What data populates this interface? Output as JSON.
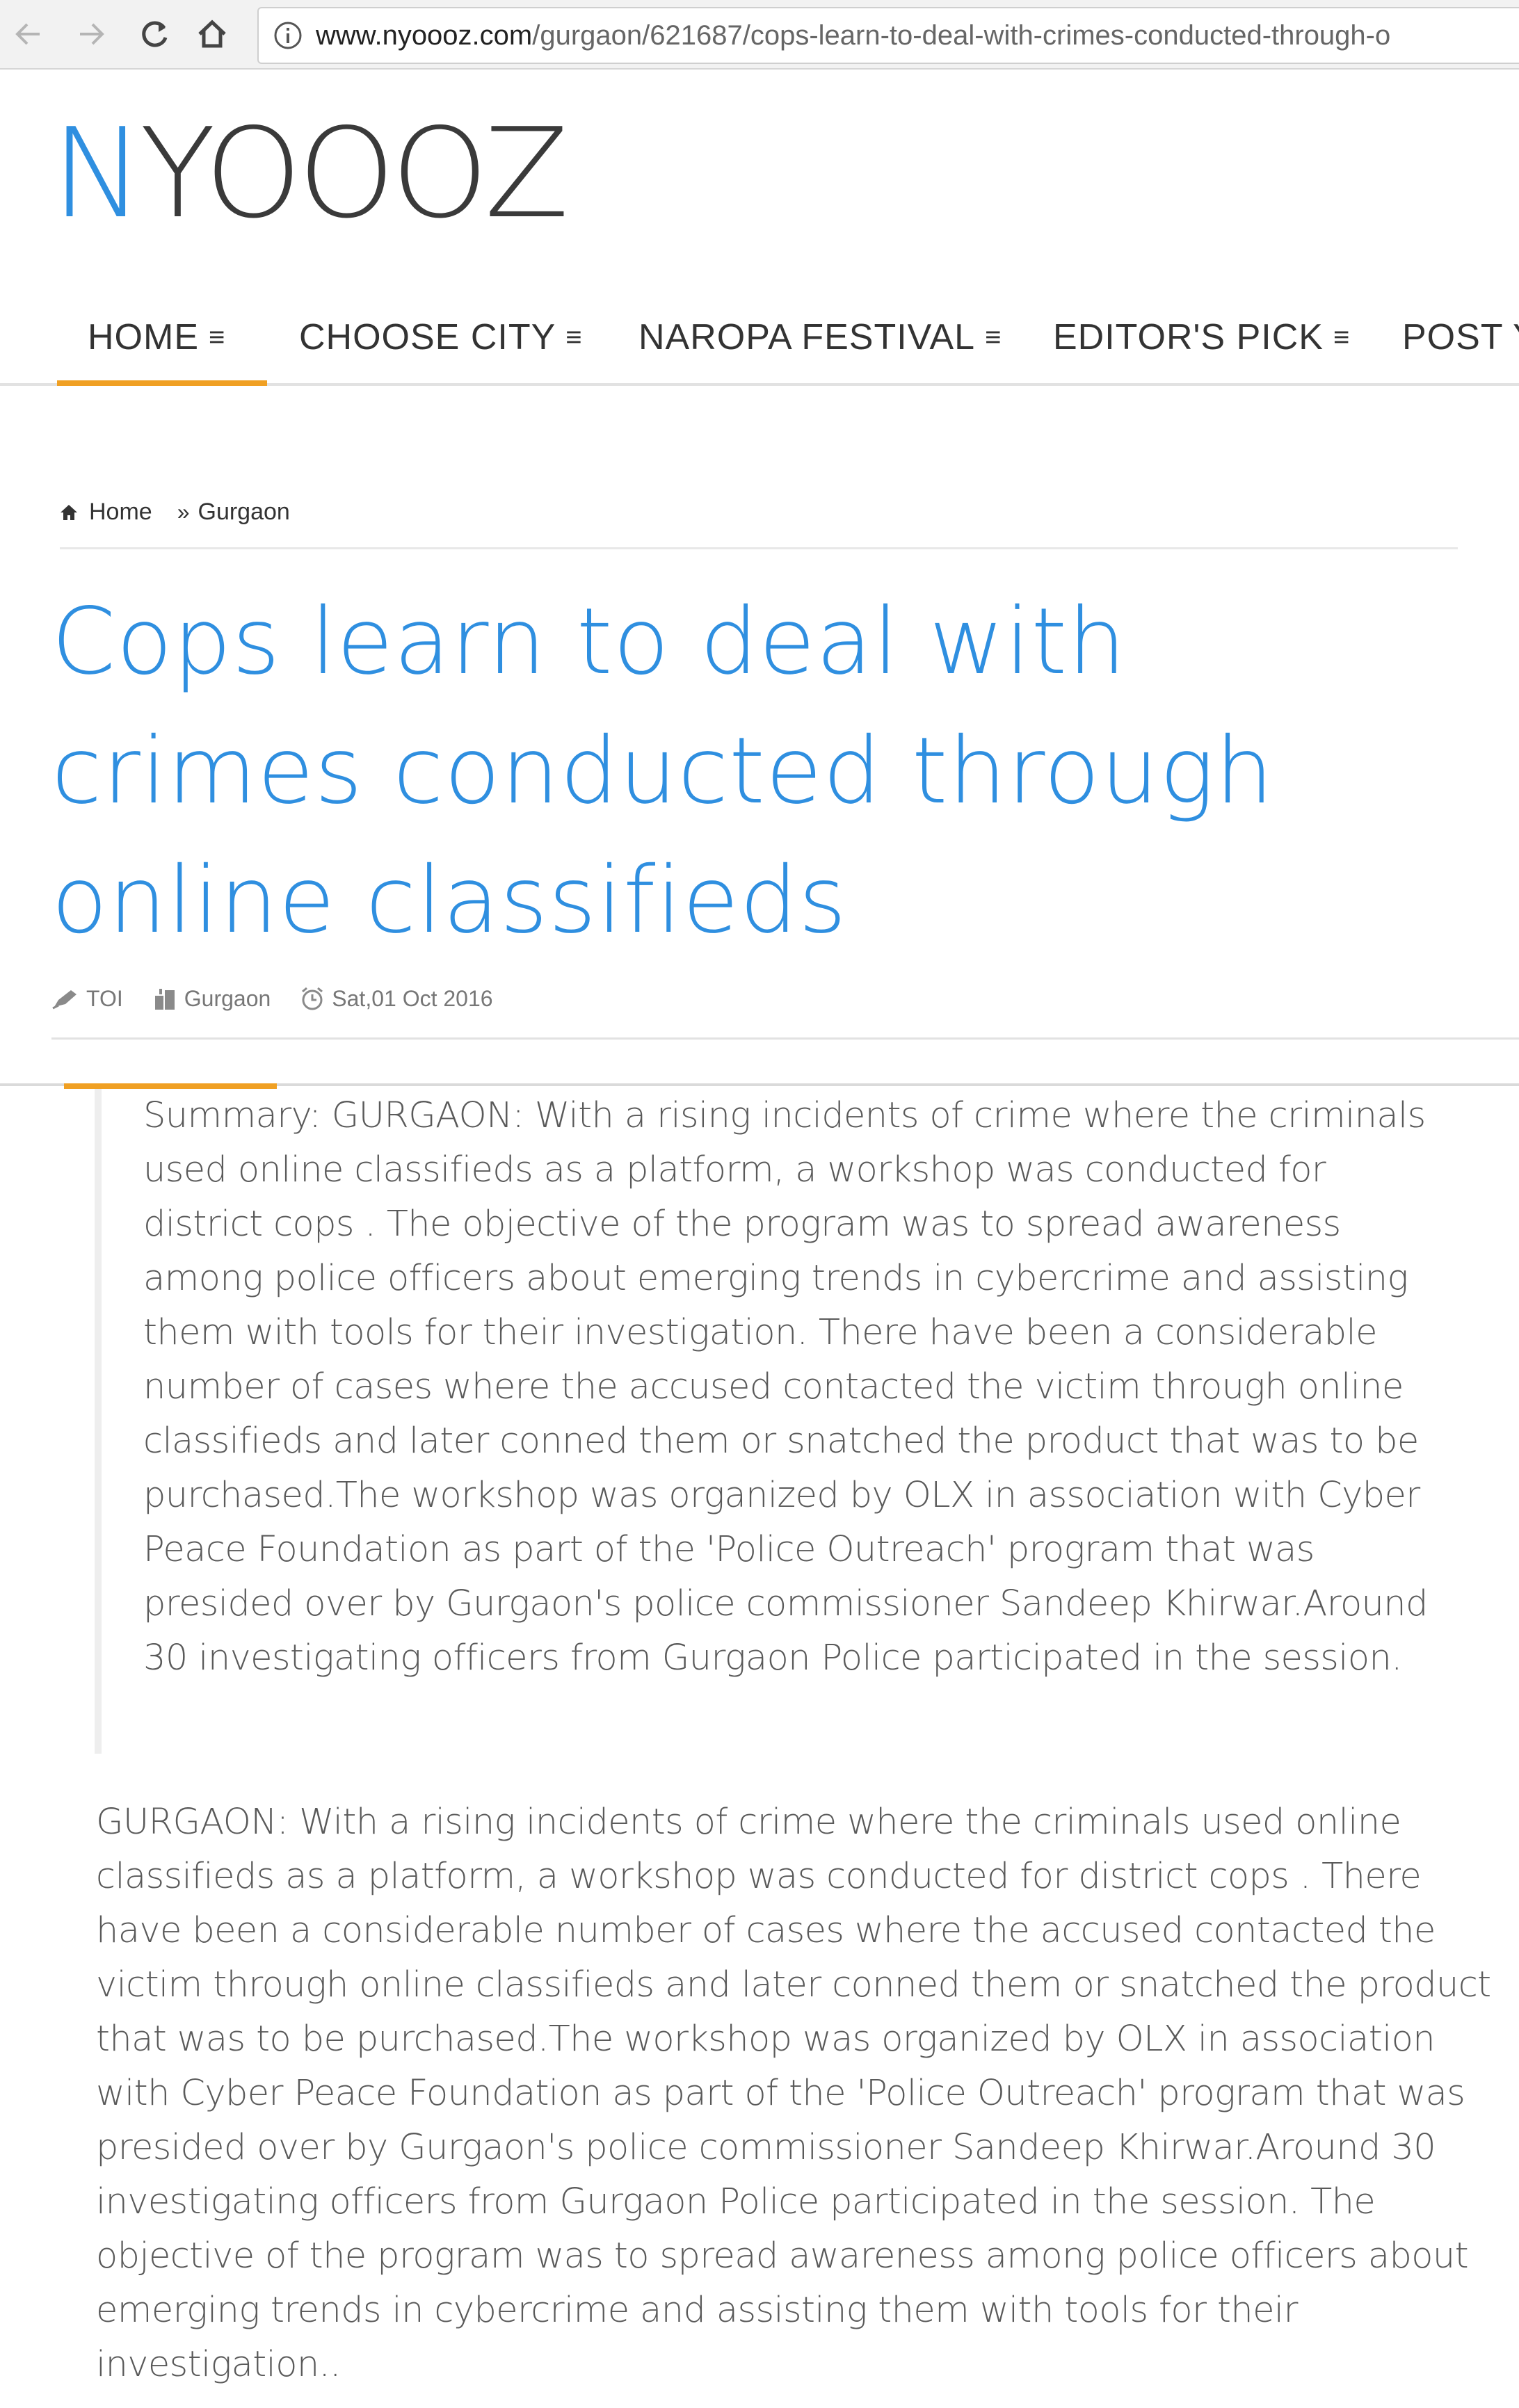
{
  "browser": {
    "url_host": "www.nyoooz.com",
    "url_path": "/gurgaon/621687/cops-learn-to-deal-with-crimes-conducted-through-o"
  },
  "site": {
    "logo_text": "NYOOOZ",
    "brand_color": "#2f8fe0",
    "accent_color": "#f0a023"
  },
  "nav": {
    "items": [
      {
        "label": "HOME"
      },
      {
        "label": "CHOOSE CITY"
      },
      {
        "label": "NAROPA FESTIVAL"
      },
      {
        "label": "EDITOR'S PICK"
      },
      {
        "label": "POST Y"
      }
    ],
    "menu_glyph": "≡"
  },
  "breadcrumb": {
    "home": "Home",
    "city": "Gurgaon",
    "separator": "»"
  },
  "article": {
    "title": "Cops learn to deal with crimes conducted through online classifieds",
    "source": "TOI",
    "city": "Gurgaon",
    "date": "Sat,01 Oct 2016",
    "summary": "Summary: GURGAON: With a rising incidents of crime where the criminals used online classifieds as a platform, a workshop was conducted for district cops . The objective of the program was to spread awareness among police officers about emerging trends in cybercrime and assisting them with tools for their investigation. There have been a considerable number of cases where the accused contacted the victim through online classifieds and later conned them or snatched the product that was to be purchased.The workshop was organized by OLX in association with Cyber Peace Foundation as part of the 'Police Outreach' program that was presided over by Gurgaon's police commissioner Sandeep Khirwar.Around 30 investigating officers from Gurgaon Police participated in the session.",
    "body": "GURGAON: With a rising incidents of crime where the criminals used online classifieds as a platform, a workshop was conducted for district cops . There have been a considerable number of cases where the accused contacted the victim through online classifieds and later conned them or snatched the product that was to be purchased.The workshop was organized by OLX in association with Cyber Peace Foundation as part of the 'Police Outreach' program that was presided over by Gurgaon's police commissioner Sandeep Khirwar.Around 30 investigating officers from Gurgaon Police participated in the session. The objective of the program was to spread awareness among police officers about emerging trends in cybercrime and assisting them with tools for their investigation.."
  },
  "icons": {
    "back": "arrow-left-icon",
    "forward": "arrow-right-icon",
    "reload": "reload-icon",
    "home": "home-icon",
    "info": "info-icon",
    "source": "pen-icon",
    "city": "building-icon",
    "date": "clock-icon"
  }
}
